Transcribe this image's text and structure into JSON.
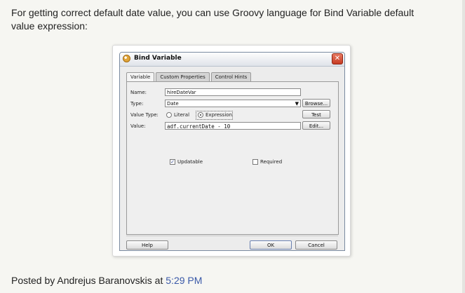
{
  "post": {
    "intro": "For getting correct default date value, you can use Groovy language for Bind Variable default value expression:",
    "posted_by_prefix": "Posted by ",
    "author": "Andrejus Baranovskis",
    "at": " at ",
    "time": "5:29 PM"
  },
  "dialog": {
    "title": "Bind Variable",
    "close_glyph": "✕",
    "tabs": [
      {
        "label": "Variable",
        "active": true
      },
      {
        "label": "Custom Properties",
        "active": false
      },
      {
        "label": "Control Hints",
        "active": false
      }
    ],
    "name_label": "Name:",
    "name_value": "hireDateVar",
    "type_label": "Type:",
    "type_value": "Date",
    "browse_label": "Browse...",
    "value_type_label": "Value Type:",
    "literal_label": "Literal",
    "expression_label": "Expression",
    "value_type_selected": "Expression",
    "test_label": "Test",
    "value_label": "Value:",
    "value_value": "adf.currentDate - 10",
    "edit_label": "Edit...",
    "updatable_label": "Updatable",
    "updatable_checked": true,
    "required_label": "Required",
    "required_checked": false,
    "help_label": "Help",
    "ok_label": "OK",
    "cancel_label": "Cancel",
    "dropdown_glyph": "▼",
    "check_glyph": "✓"
  }
}
